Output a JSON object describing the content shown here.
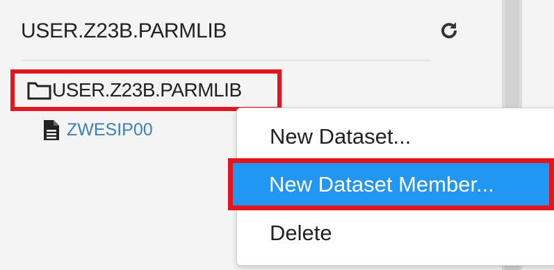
{
  "header": {
    "title": "USER.Z23B.PARMLIB",
    "refresh_icon": "refresh-icon"
  },
  "tree": {
    "root": {
      "label": "USER.Z23B.PARMLIB",
      "icon": "folder-icon"
    },
    "children": [
      {
        "label": "ZWESIP00",
        "icon": "file-icon"
      }
    ]
  },
  "context_menu": {
    "items": [
      {
        "label": "New Dataset..."
      },
      {
        "label": "New Dataset Member...",
        "selected": true
      },
      {
        "label": "Delete"
      }
    ]
  },
  "colors": {
    "highlight_border": "#e3161f",
    "menu_selected_bg": "#2196f3",
    "member_link": "#3d7fb8"
  }
}
